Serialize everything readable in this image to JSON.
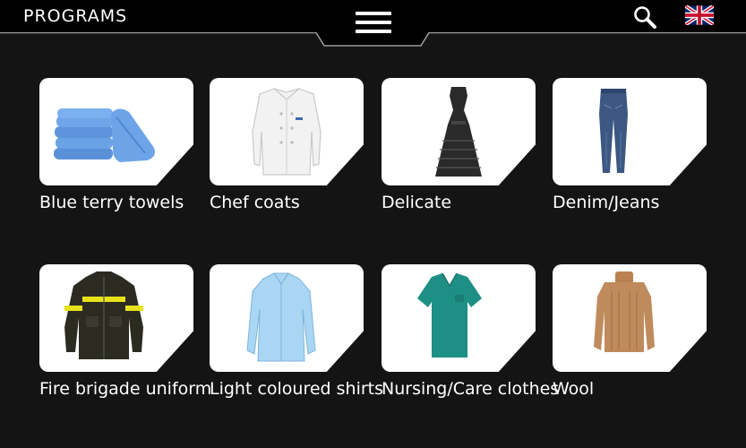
{
  "header": {
    "title": "PROGRAMS",
    "menu_icon": "hamburger-menu-icon",
    "search_icon": "search-icon",
    "language_icon": "uk-flag-icon"
  },
  "colors": {
    "background": "#141414",
    "topbar": "#000000",
    "card": "#ffffff",
    "text": "#ffffff"
  },
  "programs": [
    {
      "label": "Blue terry towels",
      "icon": "blue-towels-icon"
    },
    {
      "label": "Chef coats",
      "icon": "chef-coat-icon"
    },
    {
      "label": "Delicate",
      "icon": "dress-icon"
    },
    {
      "label": "Denim/Jeans",
      "icon": "jeans-icon"
    },
    {
      "label": "Fire brigade uniform",
      "icon": "fire-jacket-icon"
    },
    {
      "label": "Light coloured shirts",
      "icon": "shirt-icon"
    },
    {
      "label": "Nursing/Care clothes",
      "icon": "scrubs-icon"
    },
    {
      "label": "Wool",
      "icon": "sweater-icon"
    }
  ]
}
